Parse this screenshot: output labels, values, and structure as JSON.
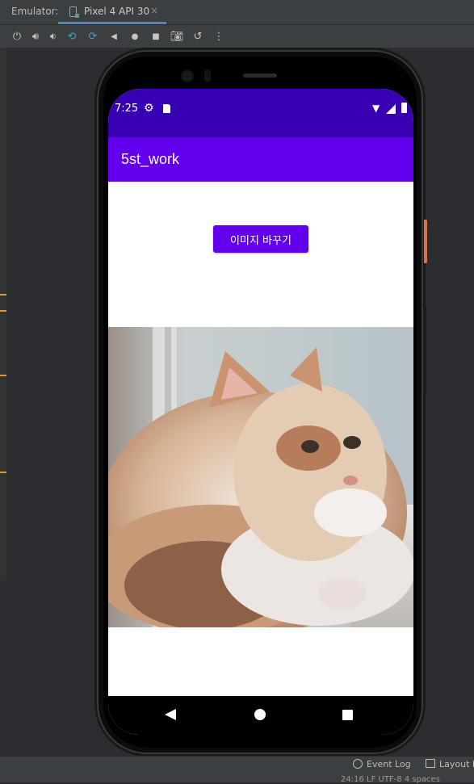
{
  "ide": {
    "emulator_label": "Emulator:",
    "device_tab": "Pixel 4 API 30",
    "tab_close": "×",
    "toolbar_icons": [
      "power-icon",
      "volume-up-icon",
      "volume-down-icon",
      "rotate-left-icon",
      "rotate-right-icon",
      "back-icon",
      "home-icon",
      "overview-icon",
      "screenshot-icon",
      "snapshot-icon",
      "more-icon"
    ],
    "bottom": {
      "event_log": "Event Log",
      "layout": "Layout In",
      "position": "24:16   LF   UTF-8   4 spaces"
    },
    "colors": {
      "accent": "#4a88c7",
      "gutter_marker": "#c8a02a",
      "power_button": "#d9744a"
    }
  },
  "device": {
    "status_bar": {
      "time": "7:25",
      "icons": [
        "gear-icon",
        "sd-card-icon",
        "wifi-icon",
        "signal-icon",
        "battery-icon"
      ]
    },
    "app_bar": {
      "title": "5st_work"
    },
    "button": {
      "label": "이미지 바꾸기"
    },
    "image": {
      "subject": "cat-photo"
    },
    "nav_bar": {
      "icons": [
        "nav-back-icon",
        "nav-home-icon",
        "nav-recent-icon"
      ]
    },
    "colors": {
      "status_bar": "#3700b3",
      "app_bar": "#6200ee",
      "button": "#6200ee"
    }
  }
}
